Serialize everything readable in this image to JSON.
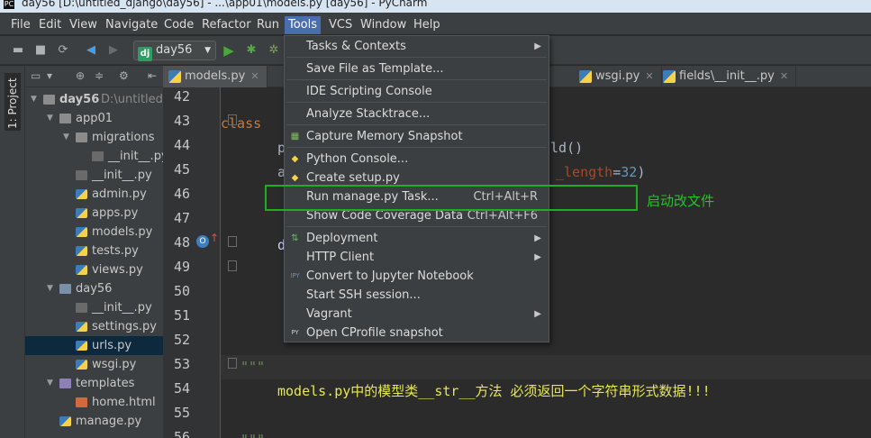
{
  "window": {
    "title": "day56 [D:\\untitled_django\\day56] - ...\\app01\\models.py [day56] - PyCharm"
  },
  "menubar": [
    "File",
    "Edit",
    "View",
    "Navigate",
    "Code",
    "Refactor",
    "Run",
    "Tools",
    "VCS",
    "Window",
    "Help"
  ],
  "toolbar": {
    "run_config": "day56",
    "run_config_badge": "dj"
  },
  "side_strip": {
    "label": "1: Project"
  },
  "project_tree": [
    {
      "label": "day56",
      "dim": "D:\\untitled_d",
      "depth": 0,
      "icon": "folder",
      "expanded": true,
      "bold": true
    },
    {
      "label": "app01",
      "depth": 1,
      "icon": "folder",
      "expanded": true
    },
    {
      "label": "migrations",
      "depth": 2,
      "icon": "folder",
      "expanded": true
    },
    {
      "label": "__init__.py",
      "depth": 3,
      "icon": "initpy"
    },
    {
      "label": "__init__.py",
      "depth": 2,
      "icon": "initpy"
    },
    {
      "label": "admin.py",
      "depth": 2,
      "icon": "py"
    },
    {
      "label": "apps.py",
      "depth": 2,
      "icon": "py"
    },
    {
      "label": "models.py",
      "depth": 2,
      "icon": "py"
    },
    {
      "label": "tests.py",
      "depth": 2,
      "icon": "py"
    },
    {
      "label": "views.py",
      "depth": 2,
      "icon": "py"
    },
    {
      "label": "day56",
      "depth": 1,
      "icon": "folder-blue",
      "expanded": true
    },
    {
      "label": "__init__.py",
      "depth": 2,
      "icon": "initpy"
    },
    {
      "label": "settings.py",
      "depth": 2,
      "icon": "py"
    },
    {
      "label": "urls.py",
      "depth": 2,
      "icon": "py",
      "selected": true
    },
    {
      "label": "wsgi.py",
      "depth": 2,
      "icon": "py"
    },
    {
      "label": "templates",
      "depth": 1,
      "icon": "folder-purple",
      "expanded": true
    },
    {
      "label": "home.html",
      "depth": 2,
      "icon": "html"
    },
    {
      "label": "manage.py",
      "depth": 1,
      "icon": "py"
    }
  ],
  "editor_tabs": [
    {
      "label": "models.py",
      "active": true
    },
    {
      "label": "wsgi.py",
      "active": false
    },
    {
      "label": "fields\\__init__.py",
      "active": false
    }
  ],
  "line_numbers": [
    "42",
    "43",
    "44",
    "45",
    "46",
    "47",
    "48",
    "49",
    "50",
    "51",
    "52",
    "53",
    "54",
    "55",
    "56"
  ],
  "code": {
    "l43_kw": "class",
    "l43_tail": "):",
    "l44_head": "p",
    "l44_tail": "eld()",
    "l45_head": "a",
    "l45_param": "_length",
    "l45_eq": "=",
    "l45_num": "32",
    "l45_close": ")",
    "l48_head": "d",
    "l53_text": "\"\"\"",
    "l54_text": "models.py中的模型类__str__方法 必须返回一个字符串形式数据!!!",
    "l56_text": "\"\"\""
  },
  "tools_menu": [
    {
      "label": "Tasks & Contexts",
      "submenu": true
    },
    {
      "sep": true
    },
    {
      "label": "Save File as Template..."
    },
    {
      "sep": true
    },
    {
      "label": "IDE Scripting Console"
    },
    {
      "sep": true
    },
    {
      "label": "Analyze Stacktrace..."
    },
    {
      "sep": true
    },
    {
      "label": "Capture Memory Snapshot",
      "icon": "memory-snapshot-icon"
    },
    {
      "sep": true
    },
    {
      "label": "Python Console...",
      "icon": "python-icon"
    },
    {
      "label": "Create setup.py",
      "icon": "python-icon"
    },
    {
      "label": "Run manage.py Task...",
      "shortcut": "Ctrl+Alt+R"
    },
    {
      "label": "Show Code Coverage Data",
      "shortcut": "Ctrl+Alt+F6"
    },
    {
      "sep": true
    },
    {
      "label": "Deployment",
      "submenu": true,
      "icon": "deployment-icon"
    },
    {
      "label": "HTTP Client",
      "submenu": true
    },
    {
      "label": "Convert to Jupyter Notebook",
      "icon": "jupyter-icon"
    },
    {
      "label": "Start SSH session..."
    },
    {
      "label": "Vagrant",
      "submenu": true
    },
    {
      "label": "Open CProfile snapshot",
      "icon": "profiler-icon"
    }
  ],
  "annotation": {
    "text": "启动改文件"
  },
  "colors": {
    "accent": "#4b6eaf",
    "annotation": "#1fae1f"
  }
}
